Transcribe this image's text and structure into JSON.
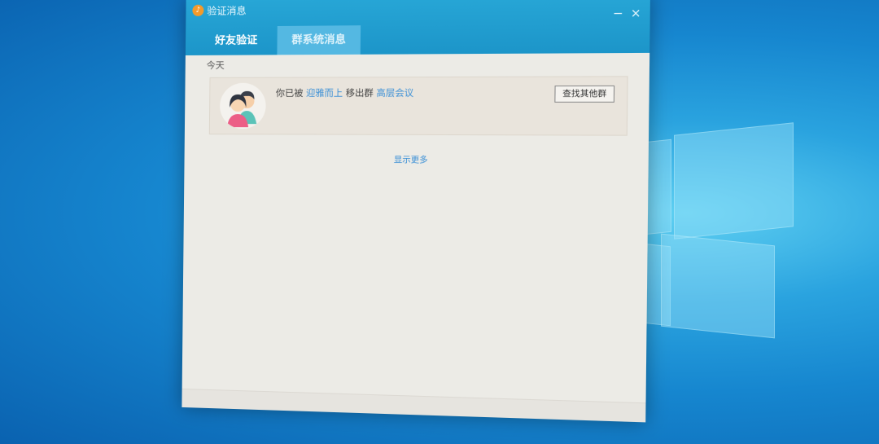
{
  "dialog": {
    "title": "验证消息",
    "tabs": [
      {
        "label": "好友验证",
        "active": false
      },
      {
        "label": "群系统消息",
        "active": true
      }
    ],
    "section_label": "今天",
    "notification": {
      "prefix": "你已被 ",
      "actor": "迎雅而上",
      "middle": " 移出群 ",
      "group": "高层会议",
      "action_button": "查找其他群"
    },
    "show_more": "显示更多",
    "window_controls": {
      "minimize": "−",
      "close": "×"
    }
  },
  "colors": {
    "titlebar": "#1c95c9",
    "active_tab": "#54b8e2",
    "link": "#3a8fd6",
    "dialog_bg": "#ecebe6"
  },
  "icons": [
    "app-logo-icon",
    "group-avatar-icon",
    "minimize-icon",
    "close-icon"
  ]
}
